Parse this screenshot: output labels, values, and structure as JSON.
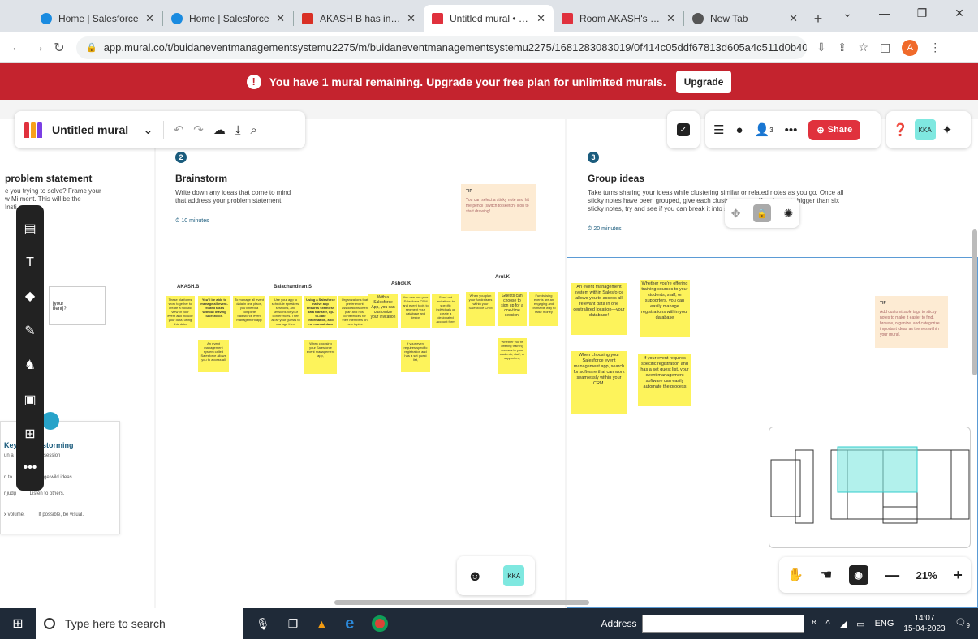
{
  "browser": {
    "tabs": [
      {
        "title": "Home | Salesforce",
        "color": "#1a8be0",
        "active": false
      },
      {
        "title": "Home | Salesforce",
        "color": "#1a8be0",
        "active": false
      },
      {
        "title": "AKASH B has invited y",
        "color": "#d93025",
        "active": false
      },
      {
        "title": "Untitled mural • buid",
        "color": "#e0313d",
        "active": true
      },
      {
        "title": "Room AKASH's room",
        "color": "#e0313d",
        "active": false
      },
      {
        "title": "New Tab",
        "color": "#555555",
        "active": false
      }
    ],
    "url": "app.mural.co/t/buidaneventmanagementsystemu2275/m/buidaneventmanagementsystemu2275/1681283083019/0f414c05ddf67813d605a4c511d0b407ffbefb4e?...",
    "avatar": "A"
  },
  "banner": {
    "text": "You have 1 mural remaining. Upgrade your free plan for unlimited murals.",
    "upgrade_label": "Upgrade"
  },
  "toolbar": {
    "title": "Untitled mural",
    "share_label": "Share",
    "user_initials": "KKA",
    "participants_count": "3"
  },
  "sections": {
    "problem": {
      "title": "problem statement",
      "text": "e you trying to solve? Frame your\nw Mi          ment. This will be the\nInsti"
    },
    "brainstorm": {
      "number": "2",
      "title": "Brainstorm",
      "text": "Write down any ideas that come to mind\nthat address your problem statement.",
      "time": "10 minutes",
      "tip_label": "TIP",
      "tip_text": "You can select a sticky note and hit the pencil (switch to sketch) icon to start drawing!"
    },
    "group": {
      "number": "3",
      "title": "Group ideas",
      "text": "Take turns sharing your ideas while clustering similar or related notes as you go. Once all sticky notes have been grouped, give each cluster a name. If a cluster is bigger than six sticky notes, try and see if you can break it into smaller groups.",
      "time": "20 minutes",
      "tip_label": "TIP",
      "tip_text": "Add customizable tags to sticky notes to make it easier to find, browse, organize, and categorize important ideas as themes within your mural."
    },
    "rules": {
      "title": "Key          nstorming",
      "items": [
        "un a          ductive session",
        "n to          Encourage wild ideas.",
        "r judg          Listen to others.",
        "x volume.          If possible, be visual."
      ]
    }
  },
  "people": [
    "AKASH.B",
    "Balachandiran.S",
    "Ashok.K",
    "Arul.K"
  ],
  "stickies_brainstorm": [
    "These platforms work together to create a holistic view of your event and include your data, using this data",
    "You'll be able to manage all event-related tasks without leaving Salesforce.",
    "To manage all event data in one place, you'll need a complete Salesforce event management app",
    "Use your app to schedule speakers, sessions, and sessions for your conferences. Then allow your guests to manage them",
    "Using a Salesforce native app ensures seamless data transfer, up-to-date information, and no manual data entry.",
    "Organizations that prefer event associations often plan and host conferences for their members on new topics",
    "With a Salesforce App, you can customize your invitation",
    "You can use your Salesforce CRM and event tools to segment your database and design",
    "Send out invitations to specific individuals or create a designated account form",
    "When you plan your fundraisers within your Salesforce CRM",
    "Guests can choose to sign up for a one-time session,",
    "Fundraising events are an engaging and profitable way to raise money",
    "An event management system called Salesforce allows you to access all",
    "When choosing your Salesforce event management app,",
    "If your event requires specific registration and has a set guest list,",
    "Whether you're offering training courses to your students, staff, or supporters,"
  ],
  "stickies_group": [
    "An event management system within Salesforce allows you to access all relevant data in one centralized location—your database!",
    "Whether you're offering training courses to your students, staff, or supporters, you can easily manage registrations within your database",
    "When choosing your Salesforce event management app, search for software that can work seamlessly within your CRM.",
    "If your event requires specific registration and has a set guest list, your event management software can easily automate the process"
  ],
  "zoom": {
    "level": "21%"
  },
  "taskbar": {
    "search_placeholder": "Type here to search",
    "address_label": "Address",
    "language": "ENG",
    "time": "14:07",
    "date": "15-04-2023",
    "notification_count": "9"
  }
}
